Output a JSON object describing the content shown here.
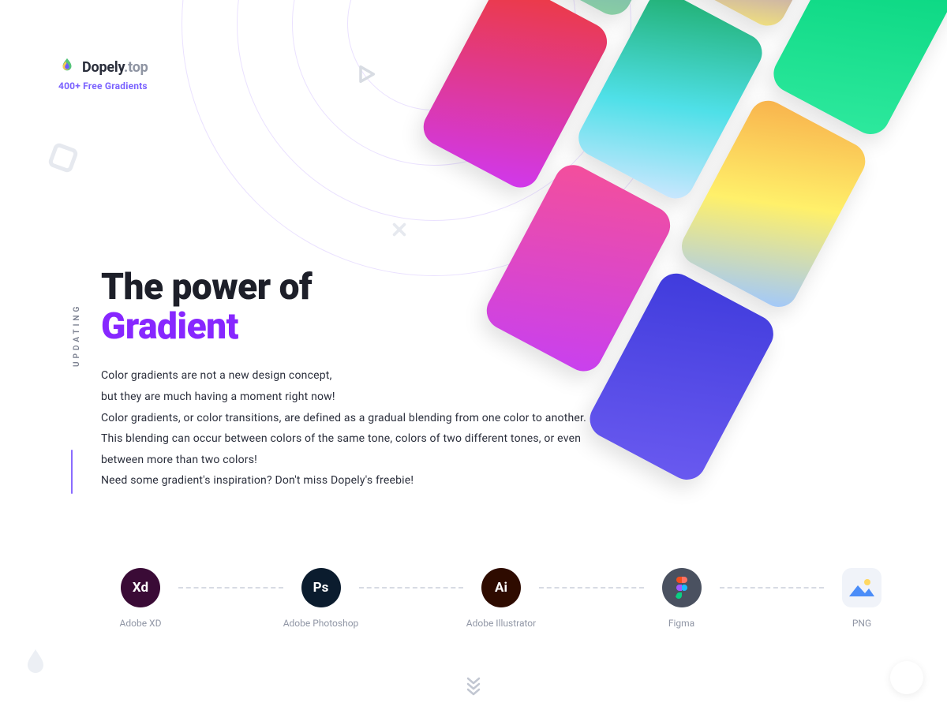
{
  "brand": {
    "name": "Dopely",
    "tld": ".top",
    "tagline": "400+ Free Gradients"
  },
  "sidebar": {
    "updating_label": "UPDATING"
  },
  "hero": {
    "title_line1": "The power of",
    "title_accent": "Gradient",
    "body": "Color gradients are not a new design concept,\nbut they are much having a moment right now!\nColor gradients, or color transitions, are defined as a gradual blending from one color to another. This blending can occur between colors of the same tone, colors of two different tones, or even between more than two colors!\nNeed some gradient's inspiration? Don't miss Dopely's freebie!"
  },
  "tools": [
    {
      "abbr": "Xd",
      "label": "Adobe XD"
    },
    {
      "abbr": "Ps",
      "label": "Adobe Photoshop"
    },
    {
      "abbr": "Ai",
      "label": "Adobe Illustrator"
    },
    {
      "abbr": "",
      "label": "Figma"
    },
    {
      "abbr": "",
      "label": "PNG"
    }
  ]
}
